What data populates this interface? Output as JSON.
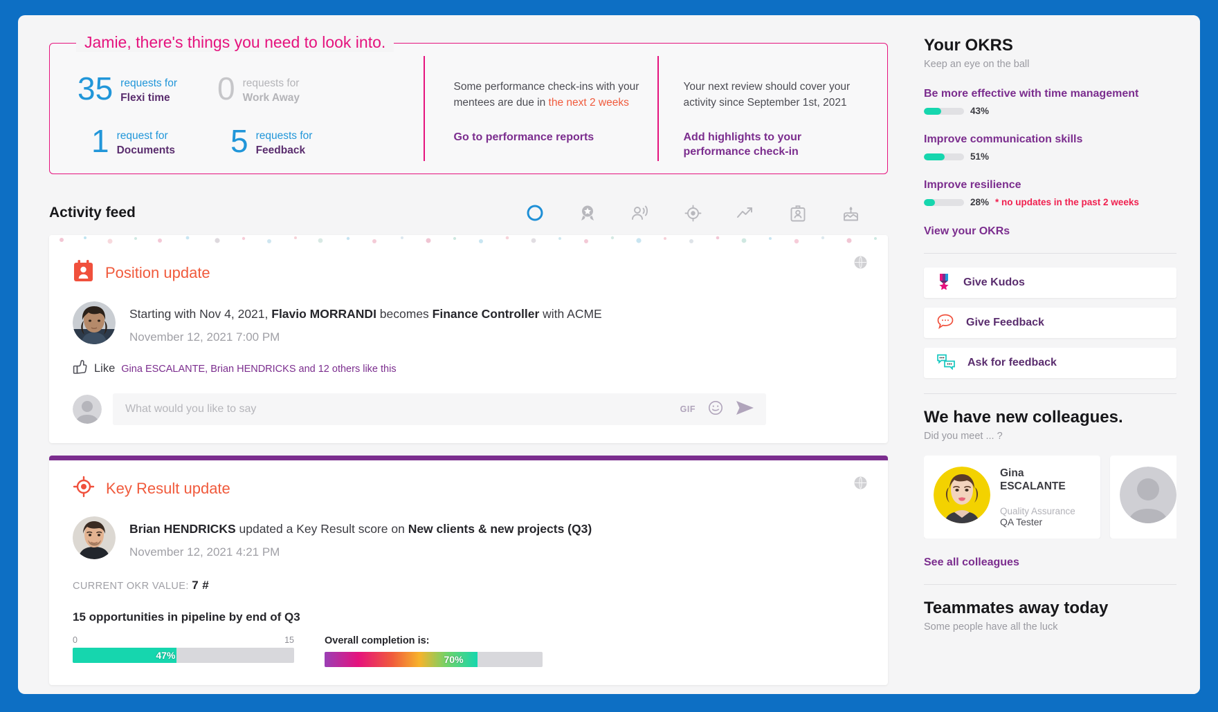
{
  "alert": {
    "title": "Jamie, there's things you need to look into.",
    "requests": [
      {
        "count": "35",
        "line1": "requests for",
        "line2": "Flexi time",
        "muted": false
      },
      {
        "count": "0",
        "line1": "requests for",
        "line2": "Work Away",
        "muted": true
      },
      {
        "count": "1",
        "line1": "request for",
        "line2": "Documents",
        "muted": false
      },
      {
        "count": "5",
        "line1": "requests for",
        "line2": "Feedback",
        "muted": false
      }
    ],
    "cell2": {
      "text_before": "Some performance check-ins with your mentees are due in ",
      "text_accent": "the next 2 weeks",
      "link": "Go to performance reports"
    },
    "cell3": {
      "text": "Your next review should cover your activity since September 1st, 2021",
      "link": "Add highlights to your performance check-in"
    }
  },
  "feed": {
    "title": "Activity feed",
    "filters": [
      {
        "name": "all-circle-icon",
        "active": true
      },
      {
        "name": "kudos-medal-icon",
        "active": false
      },
      {
        "name": "announcement-icon",
        "active": false
      },
      {
        "name": "objective-target-icon",
        "active": false
      },
      {
        "name": "performance-trend-icon",
        "active": false
      },
      {
        "name": "id-badge-icon",
        "active": false
      },
      {
        "name": "birthday-cake-icon",
        "active": false
      }
    ],
    "cards": [
      {
        "type_label": "Position update",
        "type_icon": "position-badge-icon",
        "visibility_icon": "globe-icon",
        "text_parts": [
          {
            "t": "Starting with Nov 4, 2021,",
            "b": false
          },
          {
            "t": " Flavio MORRANDI",
            "b": true
          },
          {
            "t": " becomes ",
            "b": false
          },
          {
            "t": "Finance Controller",
            "b": true
          },
          {
            "t": " with ACME",
            "b": false
          }
        ],
        "timestamp": "November 12, 2021  7:00 PM",
        "like_label": "Like",
        "like_people": "Gina ESCALANTE, Brian HENDRICKS and 12 others like this",
        "comment_placeholder": "What would you like to say",
        "comment_value": "",
        "gif_label": "GIF"
      },
      {
        "type_label": "Key Result update",
        "type_icon": "target-icon",
        "visibility_icon": "globe-icon",
        "text_parts": [
          {
            "t": "Brian HENDRICKS",
            "b": true
          },
          {
            "t": " updated a Key Result score on ",
            "b": false
          },
          {
            "t": "New clients & new projects (Q3)",
            "b": true
          }
        ],
        "timestamp": "November 12, 2021  4:21 PM",
        "okr_value_label": "CURRENT OKR VALUE:",
        "okr_value": "7 #",
        "kr_title": "15 opportunities in pipeline by end of Q3",
        "bar_min": "0",
        "bar_max": "15",
        "bar_pct": "47%",
        "overall_label": "Overall completion is:",
        "overall_pct": "70%"
      }
    ]
  },
  "sidebar": {
    "okrs": {
      "title": "Your OKRS",
      "subtitle": "Keep an eye on the ball",
      "items": [
        {
          "name": "Be more effective with time management",
          "pct": "43%",
          "value": 43,
          "warning": ""
        },
        {
          "name": "Improve communication skills",
          "pct": "51%",
          "value": 51,
          "warning": ""
        },
        {
          "name": "Improve resilience",
          "pct": "28%",
          "value": 28,
          "warning": "* no updates in the past 2 weeks"
        }
      ],
      "link": "View your OKRs"
    },
    "actions": [
      {
        "label": "Give Kudos",
        "icon": "medal-icon"
      },
      {
        "label": "Give Feedback",
        "icon": "speech-bubble-icon"
      },
      {
        "label": "Ask for feedback",
        "icon": "two-speech-bubbles-icon"
      }
    ],
    "colleagues": {
      "title": "We have new colleagues.",
      "subtitle": "Did you meet ... ?",
      "people": [
        {
          "first": "Gina",
          "last": "ESCALANTE",
          "dept": "Quality Assurance",
          "role": "QA Tester"
        }
      ],
      "link": "See all colleagues"
    },
    "away": {
      "title": "Teammates away today",
      "subtitle": "Some people have all the luck"
    }
  },
  "colors": {
    "brand_pink": "#e5127d",
    "brand_purple": "#7b2d8e",
    "accent_orange": "#f05a3c",
    "accent_blue": "#2196d9",
    "accent_teal": "#16d6ae",
    "warning_red": "#f0204f",
    "frame_blue": "#0d6fc4"
  }
}
